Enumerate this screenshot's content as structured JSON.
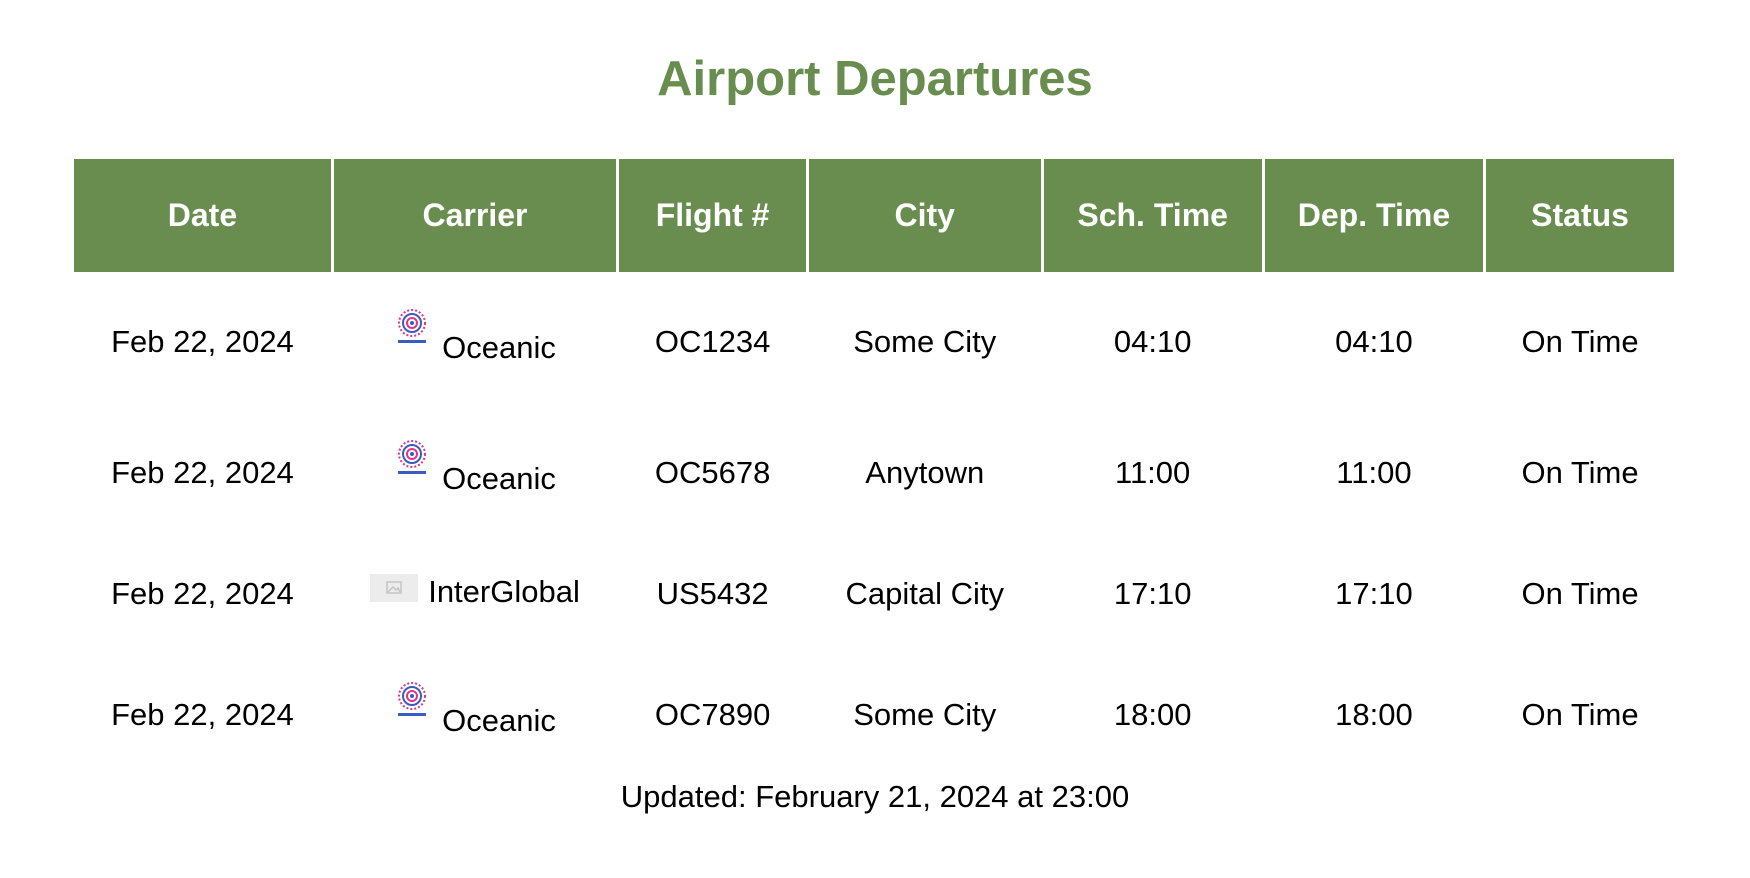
{
  "page": {
    "title": "Airport Departures",
    "updated_text": "Updated: February 21, 2024 at 23:00"
  },
  "colors": {
    "accent": "#698d4e",
    "header_text": "#ffffff"
  },
  "table": {
    "columns": [
      "Date",
      "Carrier",
      "Flight #",
      "City",
      "Sch. Time",
      "Dep. Time",
      "Status"
    ],
    "rows": [
      {
        "date": "Feb 22, 2024",
        "carrier": "Oceanic",
        "logo": "oceanic-logo-icon",
        "flight": "OC1234",
        "city": "Some City",
        "sch_time": "04:10",
        "dep_time": "04:10",
        "status": "On Time"
      },
      {
        "date": "Feb 22, 2024",
        "carrier": "Oceanic",
        "logo": "oceanic-logo-icon",
        "flight": "OC5678",
        "city": "Anytown",
        "sch_time": "11:00",
        "dep_time": "11:00",
        "status": "On Time"
      },
      {
        "date": "Feb 22, 2024",
        "carrier": "InterGlobal",
        "logo": "broken-image-icon",
        "flight": "US5432",
        "city": "Capital City",
        "sch_time": "17:10",
        "dep_time": "17:10",
        "status": "On Time"
      },
      {
        "date": "Feb 22, 2024",
        "carrier": "Oceanic",
        "logo": "oceanic-logo-icon",
        "flight": "OC7890",
        "city": "Some City",
        "sch_time": "18:00",
        "dep_time": "18:00",
        "status": "On Time"
      }
    ]
  }
}
